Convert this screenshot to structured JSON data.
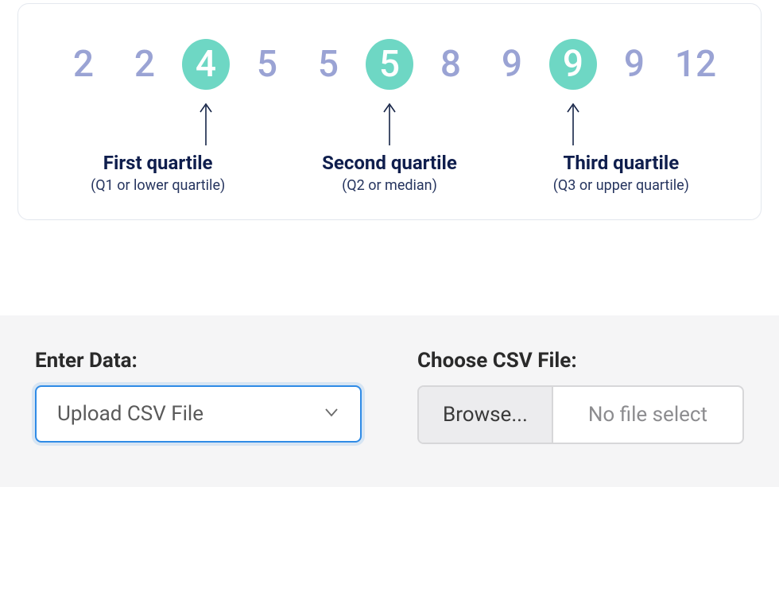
{
  "diagram": {
    "numbers": [
      {
        "value": "2",
        "highlight": false
      },
      {
        "value": "2",
        "highlight": false
      },
      {
        "value": "4",
        "highlight": true
      },
      {
        "value": "5",
        "highlight": false
      },
      {
        "value": "5",
        "highlight": false
      },
      {
        "value": "5",
        "highlight": true
      },
      {
        "value": "8",
        "highlight": false
      },
      {
        "value": "9",
        "highlight": false
      },
      {
        "value": "9",
        "highlight": true
      },
      {
        "value": "9",
        "highlight": false
      },
      {
        "value": "12",
        "highlight": false
      }
    ],
    "quartiles": [
      {
        "title": "First quartile",
        "sub": "(Q1 or lower quartile)"
      },
      {
        "title": "Second quartile",
        "sub": "(Q2 or median)"
      },
      {
        "title": "Third quartile",
        "sub": "(Q3 or upper quartile)"
      }
    ]
  },
  "form": {
    "enter_label": "Enter Data:",
    "select_value": "Upload CSV File",
    "choose_label": "Choose CSV File:",
    "browse_label": "Browse...",
    "file_status": "No file select"
  },
  "colors": {
    "highlight_bg": "#6ed7c4",
    "number_color": "#9aa3d4",
    "select_border": "#2f8be6"
  }
}
